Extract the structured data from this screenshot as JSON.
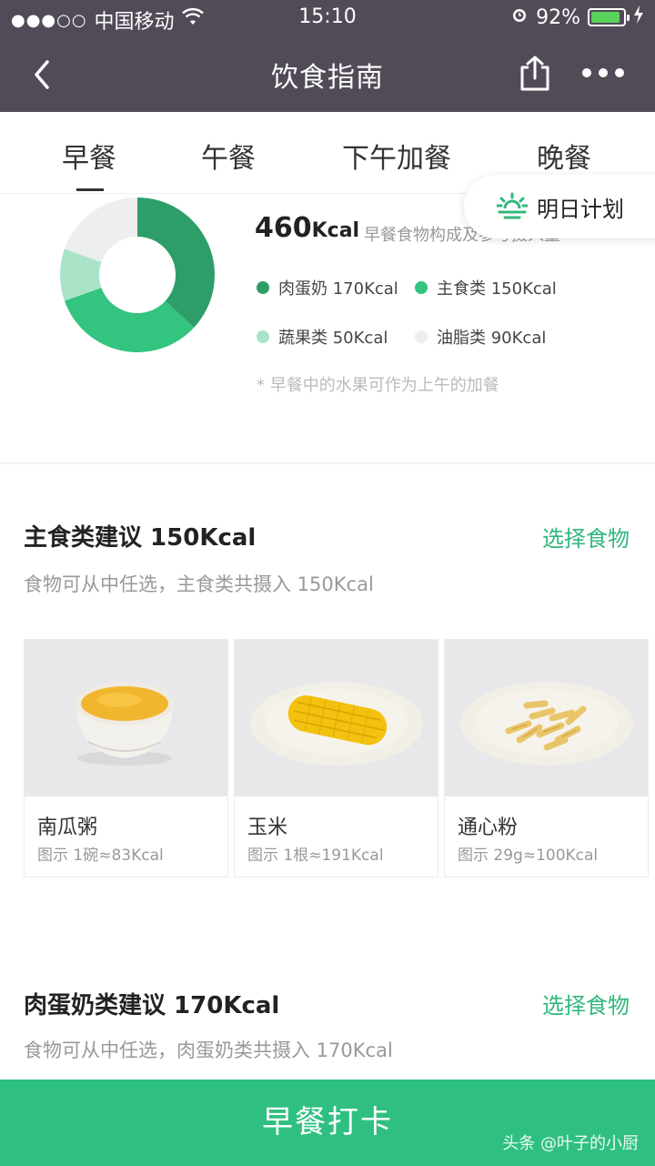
{
  "status_bar": {
    "signal": "●●●○○",
    "carrier": "中国移动",
    "time": "15:10",
    "battery": "92%",
    "battery_level": 0.92
  },
  "nav": {
    "title": "饮食指南"
  },
  "tabs": [
    {
      "label": "早餐",
      "active": true
    },
    {
      "label": "午餐"
    },
    {
      "label": "下午加餐"
    },
    {
      "label": "晚餐"
    }
  ],
  "plan_button": {
    "label": "明日计划"
  },
  "summary": {
    "total_value": "460",
    "total_unit": "Kcal",
    "description": "早餐食物构成及参考摄入量",
    "legend": [
      {
        "label": "肉蛋奶 170Kcal",
        "value": 170,
        "color": "#2e9e68"
      },
      {
        "label": "主食类 150Kcal",
        "value": 150,
        "color": "#33c47f"
      },
      {
        "label": "蔬果类 50Kcal",
        "value": 50,
        "color": "#a9e4c9"
      },
      {
        "label": "油脂类 90Kcal",
        "value": 90,
        "color": "#eceef0"
      }
    ],
    "note": "* 早餐中的水果可作为上午的加餐"
  },
  "staple_section": {
    "title": "主食类建议 150Kcal",
    "link": "选择食物",
    "subtitle": "食物可从中任选，主食类共摄入 150Kcal",
    "foods": [
      {
        "name": "南瓜粥",
        "portion": "图示 1碗≈83Kcal"
      },
      {
        "name": "玉米",
        "portion": "图示 1根≈191Kcal"
      },
      {
        "name": "通心粉",
        "portion": "图示 29g≈100Kcal"
      }
    ]
  },
  "protein_section": {
    "title": "肉蛋奶类建议 170Kcal",
    "link": "选择食物",
    "subtitle": "食物可从中任选，肉蛋奶类共摄入 170Kcal"
  },
  "checkin_button": {
    "label": "早餐打卡"
  },
  "watermark": "头条 @叶子的小厨"
}
